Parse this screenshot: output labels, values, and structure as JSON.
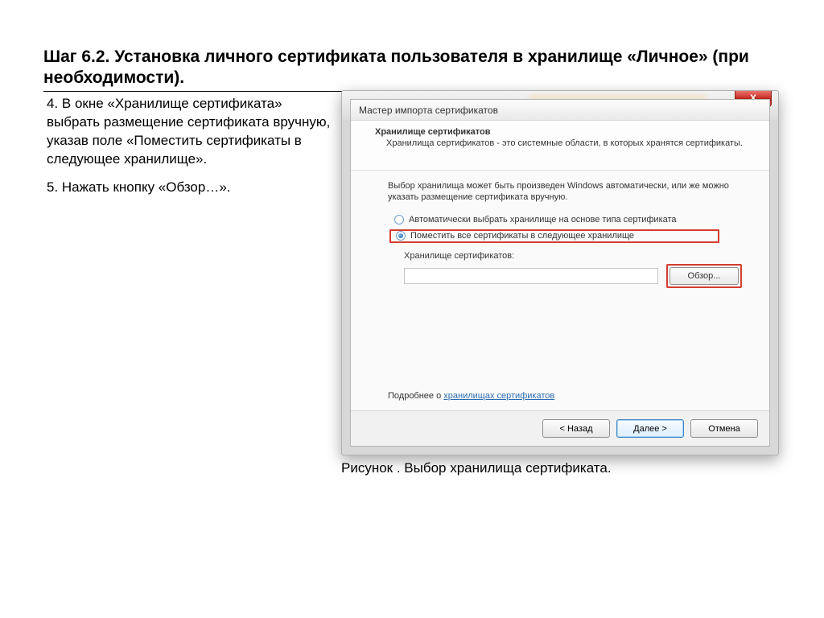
{
  "doc": {
    "heading": "Шаг 6.2. Установка личного сертификата пользователя в хранилище «Личное» (при необходимости).",
    "step4": "4. В окне «Хранилище сертификата» выбрать размещение сертификата вручную, указав поле «Поместить сертификаты в следующее хранилище».",
    "step5": "5. Нажать кнопку «Обзор…».",
    "caption": "Рисунок . Выбор хранилища сертификата."
  },
  "window": {
    "close_x": "X",
    "title": "Мастер импорта сертификатов",
    "sub_title": "Хранилище сертификатов",
    "sub_text": "Хранилища сертификатов - это системные области, в которых хранятся сертификаты.",
    "intro": "Выбор хранилища может быть произведен Windows автоматически, или же можно указать размещение сертификата вручную.",
    "radio1": "Автоматически выбрать хранилище на основе типа сертификата",
    "radio2": "Поместить все сертификаты в следующее хранилище",
    "store_label": "Хранилище сертификатов:",
    "browse_btn": "Обзор...",
    "link_prefix": "Подробнее о ",
    "link_text": "хранилищах сертификатов",
    "btn_back": "< Назад",
    "btn_next": "Далее >",
    "btn_cancel": "Отмена"
  }
}
